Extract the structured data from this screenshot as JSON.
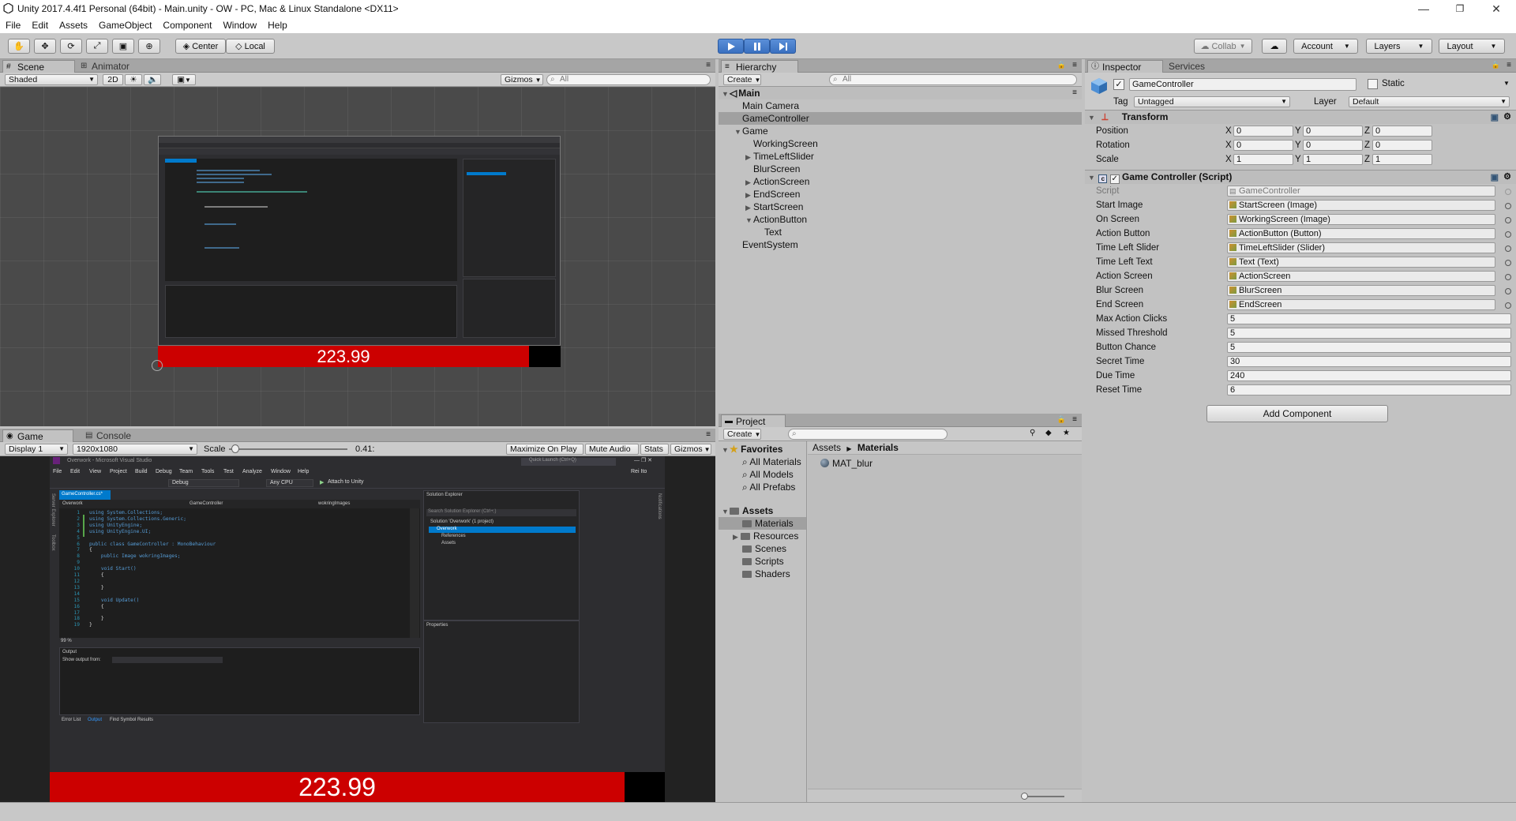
{
  "window": {
    "title": "Unity 2017.4.4f1 Personal (64bit) - Main.unity - OW - PC, Mac & Linux Standalone <DX11>",
    "controls": [
      "—",
      "❐",
      "✕"
    ]
  },
  "menu": [
    "File",
    "Edit",
    "Assets",
    "GameObject",
    "Component",
    "Window",
    "Help"
  ],
  "toolbar": {
    "pivot": "Center",
    "space": "Local",
    "collab": "Collab",
    "account": "Account",
    "layers": "Layers",
    "layout": "Layout"
  },
  "scene": {
    "tabs": [
      "Scene",
      "Animator"
    ],
    "shading": "Shaded",
    "mode2d": "2D",
    "gizmos": "Gizmos",
    "search_placeholder": "All",
    "timer": "223.99"
  },
  "game": {
    "tabs": [
      "Game",
      "Console"
    ],
    "display": "Display 1",
    "resolution": "1920x1080",
    "scale_label": "Scale",
    "scale_value": "0.41",
    "scale_fraction": 0.05,
    "maximize": "Maximize On Play",
    "mute": "Mute Audio",
    "stats": "Stats",
    "gizmos": "Gizmos",
    "timer": "223.99"
  },
  "vs": {
    "title": "Overwork - Microsoft Visual Studio",
    "menu": [
      "File",
      "Edit",
      "View",
      "Project",
      "Build",
      "Debug",
      "Team",
      "Tools",
      "Test",
      "Analyze",
      "Window",
      "Help"
    ],
    "quicklaunch": "Quick Launch (Ctrl+Q)",
    "user": "Rei Ito",
    "config": "Debug",
    "platform": "Any CPU",
    "attach": "Attach to Unity",
    "doc_tab": "GameController.cs*",
    "nav_project": "Overwork",
    "nav_class": "GameController",
    "nav_member": "wokringImages",
    "side_left": [
      "Server Explorer",
      "Toolbox"
    ],
    "side_right": "Notifications",
    "code_lines": [
      {
        "n": "1",
        "t": "using System.Collections;"
      },
      {
        "n": "2",
        "t": "using System.Collections.Generic;"
      },
      {
        "n": "3",
        "t": "using UnityEngine;"
      },
      {
        "n": "4",
        "t": "using UnityEngine.UI;"
      },
      {
        "n": "5",
        "t": ""
      },
      {
        "n": "6",
        "t": "public class GameController : MonoBehaviour"
      },
      {
        "n": "7",
        "t": "{"
      },
      {
        "n": "8",
        "t": "    public Image wokringImages;"
      },
      {
        "n": "9",
        "t": ""
      },
      {
        "n": "10",
        "t": "    void Start()"
      },
      {
        "n": "11",
        "t": "    {"
      },
      {
        "n": "12",
        "t": ""
      },
      {
        "n": "13",
        "t": "    }"
      },
      {
        "n": "14",
        "t": ""
      },
      {
        "n": "15",
        "t": "    void Update()"
      },
      {
        "n": "16",
        "t": "    {"
      },
      {
        "n": "17",
        "t": ""
      },
      {
        "n": "18",
        "t": "    }"
      },
      {
        "n": "19",
        "t": "}"
      }
    ],
    "zoom": "99 %",
    "solution_title": "Solution Explorer",
    "solution_search": "Search Solution Explorer (Ctrl+;)",
    "solution_items": [
      "Solution 'Overwork' (1 project)",
      "Overwork",
      "References",
      "Assets"
    ],
    "properties_title": "Properties",
    "output_title": "Output",
    "output_from": "Show output from:",
    "bottom_tabs": [
      "Error List",
      "Output",
      "Find Symbol Results"
    ]
  },
  "hierarchy": {
    "tab": "Hierarchy",
    "create": "Create",
    "search_placeholder": "All",
    "scene_name": "Main",
    "items": [
      {
        "label": "Main Camera",
        "depth": 1,
        "arrow": "",
        "selected": false
      },
      {
        "label": "GameController",
        "depth": 1,
        "arrow": "",
        "selected": true
      },
      {
        "label": "Game",
        "depth": 1,
        "arrow": "▼",
        "selected": false
      },
      {
        "label": "WorkingScreen",
        "depth": 2,
        "arrow": "",
        "selected": false
      },
      {
        "label": "TimeLeftSlider",
        "depth": 2,
        "arrow": "▶",
        "selected": false
      },
      {
        "label": "BlurScreen",
        "depth": 2,
        "arrow": "",
        "selected": false
      },
      {
        "label": "ActionScreen",
        "depth": 2,
        "arrow": "▶",
        "selected": false
      },
      {
        "label": "EndScreen",
        "depth": 2,
        "arrow": "▶",
        "selected": false
      },
      {
        "label": "StartScreen",
        "depth": 2,
        "arrow": "▶",
        "selected": false
      },
      {
        "label": "ActionButton",
        "depth": 2,
        "arrow": "▼",
        "selected": false
      },
      {
        "label": "Text",
        "depth": 3,
        "arrow": "",
        "selected": false
      },
      {
        "label": "EventSystem",
        "depth": 1,
        "arrow": "",
        "selected": false
      }
    ]
  },
  "project": {
    "tab": "Project",
    "create": "Create",
    "favorites_label": "Favorites",
    "favorites": [
      "All Materials",
      "All Models",
      "All Prefabs"
    ],
    "assets_label": "Assets",
    "assets_folders": [
      "Materials",
      "Resources",
      "Scenes",
      "Scripts",
      "Shaders"
    ],
    "breadcrumb_root": "Assets",
    "breadcrumb_current": "Materials",
    "files": [
      "MAT_blur"
    ]
  },
  "inspector": {
    "tabs": [
      "Inspector",
      "Services"
    ],
    "object_name": "GameController",
    "static_label": "Static",
    "tag_label": "Tag",
    "tag_value": "Untagged",
    "layer_label": "Layer",
    "layer_value": "Default",
    "transform_title": "Transform",
    "transform_rows": [
      {
        "label": "Position",
        "x": "0",
        "y": "0",
        "z": "0"
      },
      {
        "label": "Rotation",
        "x": "0",
        "y": "0",
        "z": "0"
      },
      {
        "label": "Scale",
        "x": "1",
        "y": "1",
        "z": "1"
      }
    ],
    "axis_labels": [
      "X",
      "Y",
      "Z"
    ],
    "script_title": "Game Controller (Script)",
    "script_field_label": "Script",
    "script_field_value": "GameController",
    "fields": [
      {
        "label": "Start Image",
        "value": "StartScreen (Image)",
        "kind": "obj"
      },
      {
        "label": "On Screen",
        "value": "WorkingScreen (Image)",
        "kind": "obj"
      },
      {
        "label": "Action Button",
        "value": "ActionButton (Button)",
        "kind": "obj"
      },
      {
        "label": "Time Left Slider",
        "value": "TimeLeftSlider (Slider)",
        "kind": "obj"
      },
      {
        "label": "Time Left Text",
        "value": "Text (Text)",
        "kind": "obj"
      },
      {
        "label": "Action Screen",
        "value": "ActionScreen",
        "kind": "obj"
      },
      {
        "label": "Blur Screen",
        "value": "BlurScreen",
        "kind": "obj"
      },
      {
        "label": "End Screen",
        "value": "EndScreen",
        "kind": "obj"
      },
      {
        "label": "Max Action Clicks",
        "value": "5",
        "kind": "num"
      },
      {
        "label": "Missed Threshold",
        "value": "5",
        "kind": "num"
      },
      {
        "label": "Button Chance",
        "value": "5",
        "kind": "num"
      },
      {
        "label": "Secret Time",
        "value": "30",
        "kind": "num"
      },
      {
        "label": "Due Time",
        "value": "240",
        "kind": "num"
      },
      {
        "label": "Reset Time",
        "value": "6",
        "kind": "num"
      }
    ],
    "add_component": "Add Component"
  },
  "colors": {
    "editor_bg": "#c2c2c2",
    "selection": "#a0a0a0",
    "timer_red": "#cc0000",
    "vs_bg": "#2d2d30",
    "play_blue": "#3a70c0"
  }
}
